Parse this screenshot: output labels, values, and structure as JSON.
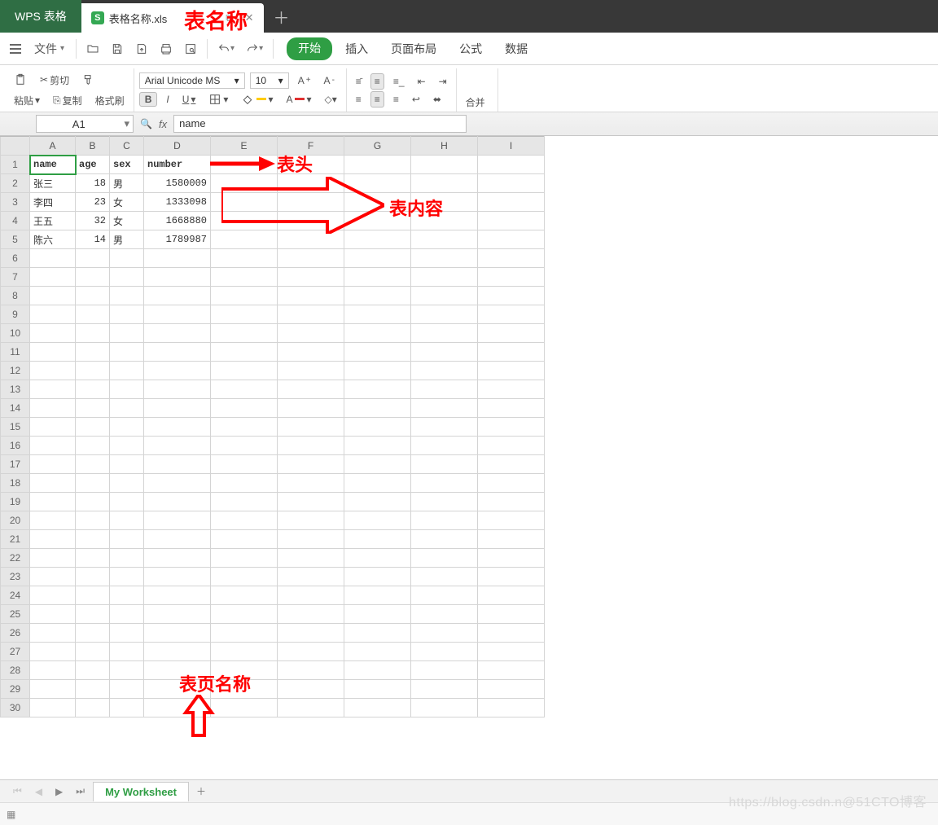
{
  "tabs": {
    "app_name": "WPS 表格",
    "file_name": "表格名称.xls"
  },
  "menu": {
    "file_label": "文件",
    "ribbon": [
      "开始",
      "插入",
      "页面布局",
      "公式",
      "数据"
    ],
    "active_index": 0
  },
  "clipboard": {
    "paste": "粘贴",
    "cut": "剪切",
    "copy": "复制",
    "format_painter": "格式刷"
  },
  "font": {
    "name": "Arial Unicode MS",
    "size": "10"
  },
  "merge_label": "合并",
  "formula": {
    "cell_ref": "A1",
    "value": "name"
  },
  "columns": [
    "A",
    "B",
    "C",
    "D",
    "E",
    "F",
    "G",
    "H",
    "I"
  ],
  "row_count": 30,
  "table": {
    "headers": [
      "name",
      "age",
      "sex",
      "number"
    ],
    "rows": [
      [
        "张三",
        "18",
        "男",
        "1580009"
      ],
      [
        "李四",
        "23",
        "女",
        "1333098"
      ],
      [
        "王五",
        "32",
        "女",
        "1668880"
      ],
      [
        "陈六",
        "14",
        "男",
        "1789987"
      ]
    ]
  },
  "sheet": {
    "name": "My Worksheet"
  },
  "annotations": {
    "table_name": "表名称",
    "header_label": "表头",
    "content_label": "表内容",
    "sheet_label": "表页名称"
  },
  "watermark": "https://blog.csdn.n@51CTO博客"
}
